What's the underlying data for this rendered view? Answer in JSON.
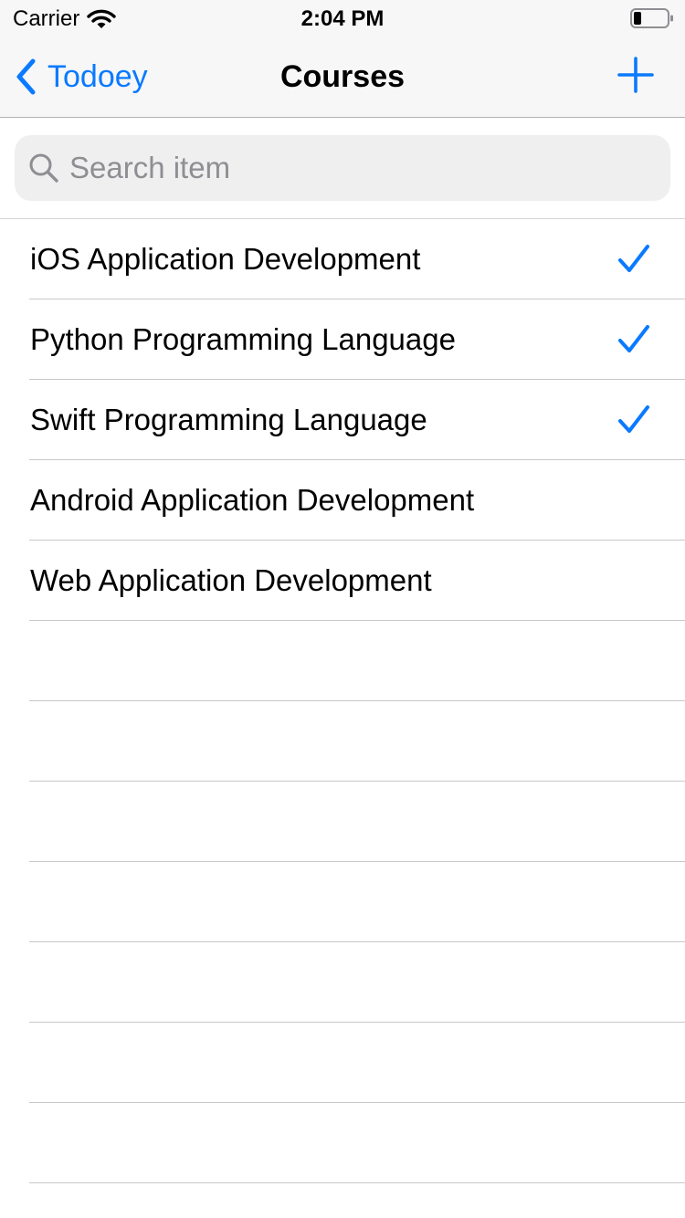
{
  "status_bar": {
    "carrier": "Carrier",
    "time": "2:04 PM"
  },
  "nav": {
    "back_label": "Todoey",
    "title": "Courses",
    "add_icon": "plus-icon",
    "back_icon": "chevron-left-icon"
  },
  "search": {
    "placeholder": "Search item",
    "value": ""
  },
  "courses": [
    {
      "label": "iOS Application Development",
      "done": true
    },
    {
      "label": "Python Programming Language",
      "done": true
    },
    {
      "label": "Swift Programming Language",
      "done": true
    },
    {
      "label": "Android Application Development",
      "done": false
    },
    {
      "label": "Web Application Development",
      "done": false
    }
  ],
  "colors": {
    "accent": "#0a7aff",
    "nav_background": "#f7f7f7",
    "search_field": "#efeff0",
    "separator": "#c8c7cc",
    "placeholder": "#8e8e93"
  }
}
